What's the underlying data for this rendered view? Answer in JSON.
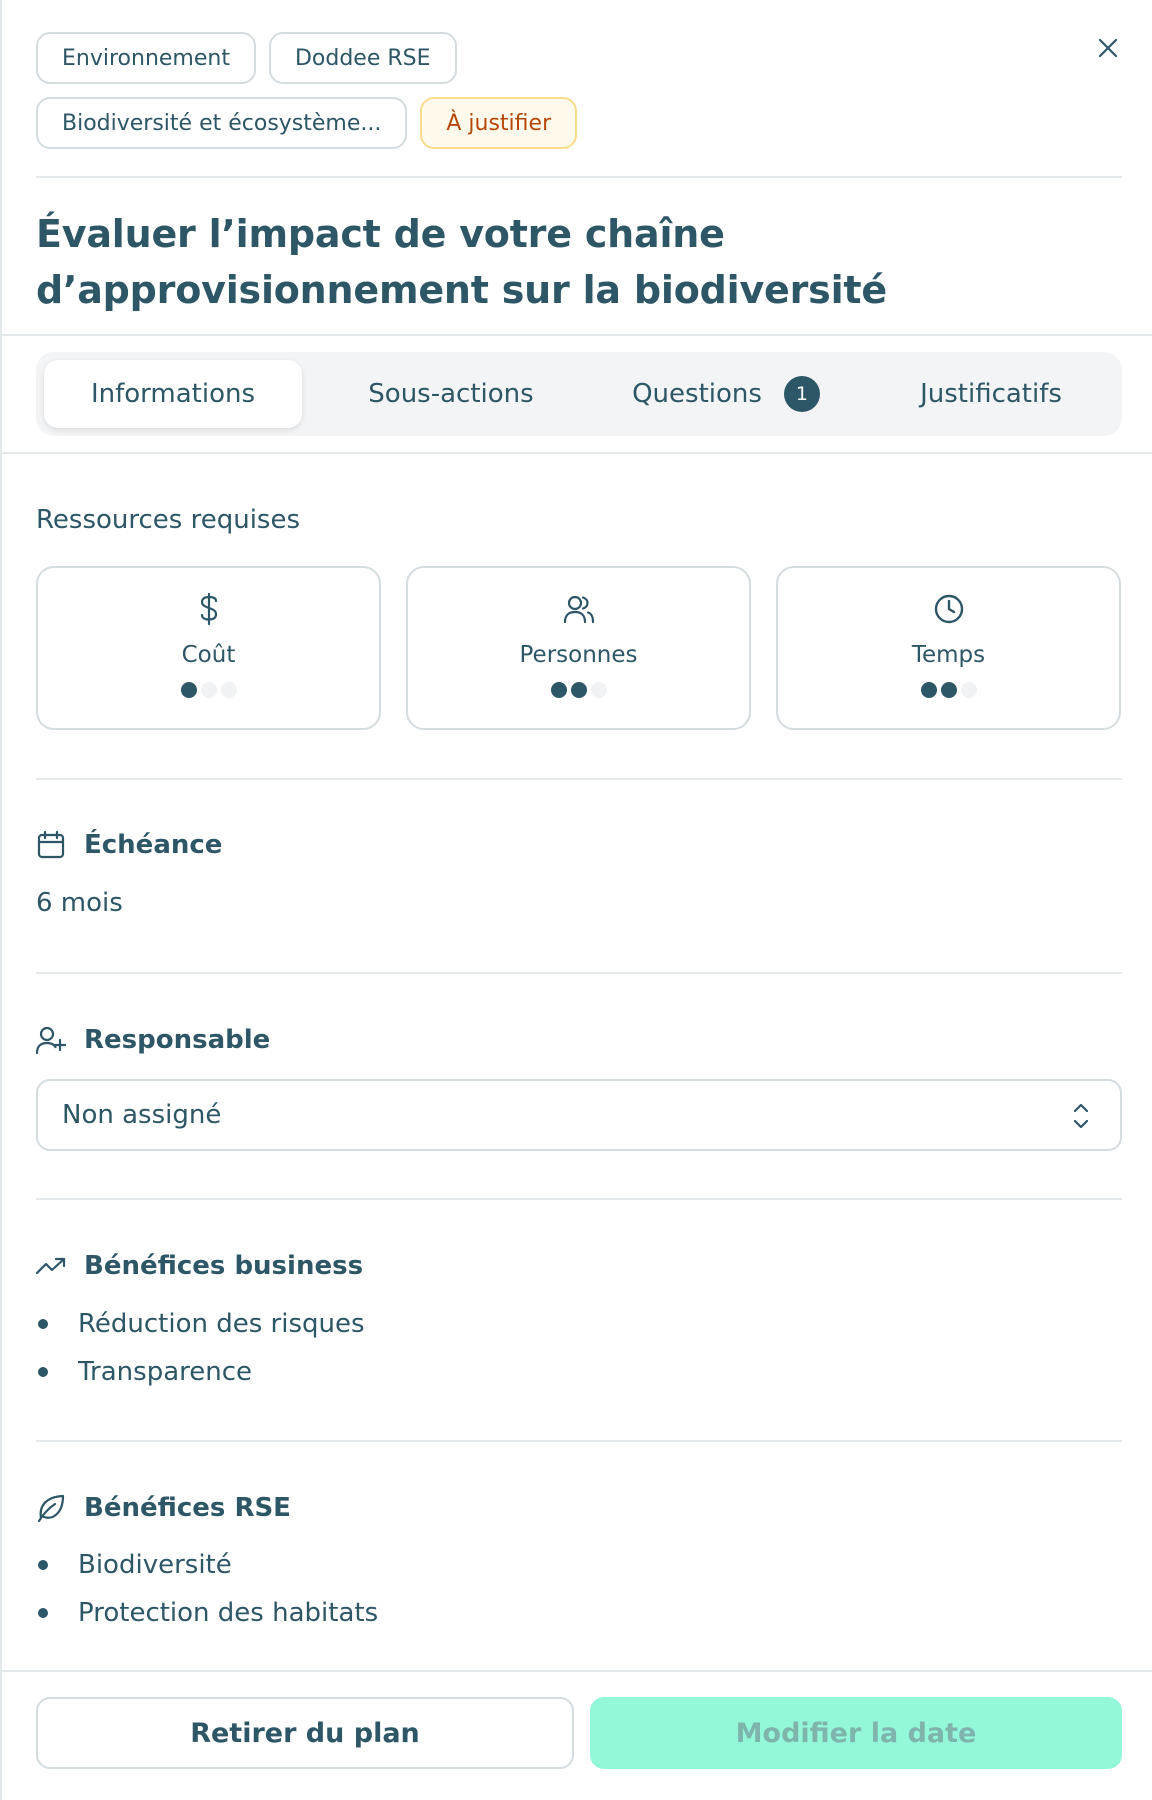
{
  "tags": {
    "row1": [
      "Environnement",
      "Doddee RSE"
    ],
    "row2": [
      "Biodiversité et écosystème...",
      "À justifier"
    ]
  },
  "title": "Évaluer l’impact de votre chaîne d’approvisionnement sur la biodiversité",
  "tabs": [
    {
      "label": "Informations",
      "active": true
    },
    {
      "label": "Sous-actions"
    },
    {
      "label": "Questions",
      "badge": "1"
    },
    {
      "label": "Justificatifs"
    }
  ],
  "resources": {
    "title": "Ressources requises",
    "items": [
      {
        "label": "Coût",
        "icon": "dollar-icon",
        "level": 1,
        "max": 3
      },
      {
        "label": "Personnes",
        "icon": "users-icon",
        "level": 2,
        "max": 3
      },
      {
        "label": "Temps",
        "icon": "clock-icon",
        "level": 2,
        "max": 3
      }
    ]
  },
  "deadline": {
    "title": "Échéance",
    "value": "6 mois",
    "icon": "calendar-icon"
  },
  "owner": {
    "title": "Responsable",
    "value": "Non assigné",
    "icon": "user-plus-icon"
  },
  "business": {
    "title": "Bénéfices business",
    "icon": "trending-up-icon",
    "items": [
      "Réduction des risques",
      "Transparence"
    ]
  },
  "rse": {
    "title": "Bénéfices RSE",
    "icon": "leaf-icon",
    "items": [
      "Biodiversité",
      "Protection des habitats"
    ]
  },
  "footer": {
    "secondary": "Retirer du plan",
    "primary": "Modifier la date"
  },
  "colors": {
    "text": "#2d5666",
    "border": "#d5dcdf",
    "warn_bg": "#fffaeb",
    "warn_text": "#b54708",
    "primary_bg": "#93f8d9"
  }
}
